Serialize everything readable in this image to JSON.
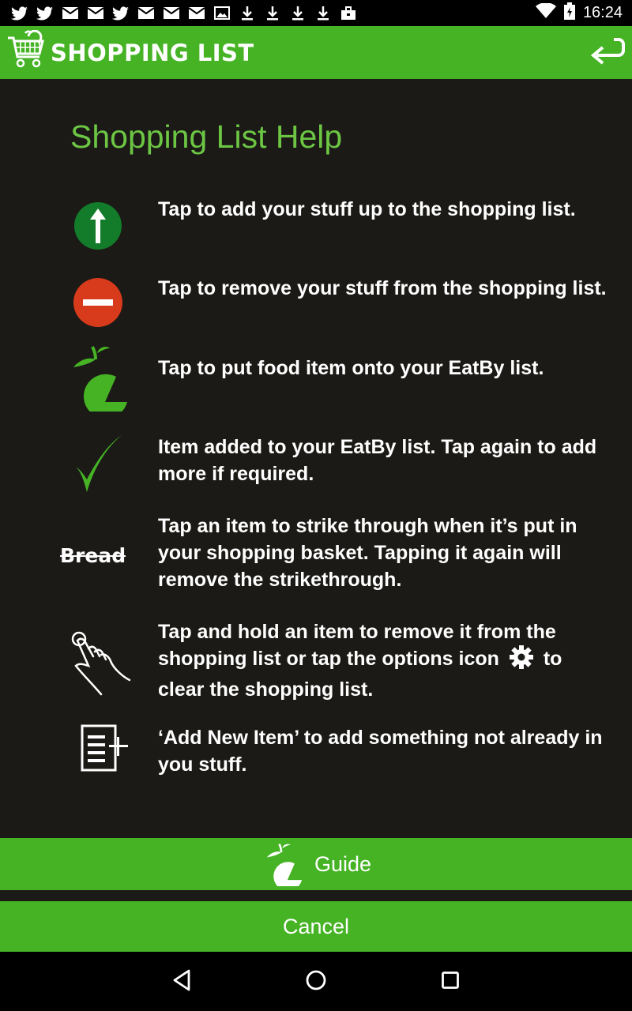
{
  "status_bar": {
    "time": "16:24",
    "notification_icons": [
      "twitter-icon",
      "twitter-icon",
      "mail-icon",
      "mail-icon",
      "twitter-icon",
      "mail-icon",
      "mail-icon",
      "mail-icon",
      "image-icon",
      "download-icon",
      "download-icon",
      "download-icon",
      "download-icon",
      "briefcase-icon"
    ],
    "system_icons": [
      "wifi-icon",
      "battery-icon"
    ]
  },
  "app_bar": {
    "title": "SHOPPING LIST",
    "back_icon": "back-arrow-icon"
  },
  "help": {
    "title": "Shopping List Help",
    "items": [
      {
        "icon": "green-up-arrow-icon",
        "text": "Tap to add your stuff up to the shopping list."
      },
      {
        "icon": "red-remove-icon",
        "text": "Tap to remove your stuff from the shopping list."
      },
      {
        "icon": "eatby-leaf-icon",
        "text": "Tap to put food item onto your EatBy list."
      },
      {
        "icon": "green-checkmark-icon",
        "text": "Item added to your EatBy list. Tap again to add more if required."
      },
      {
        "icon": "strikethrough-example",
        "example_word": "Bread",
        "text": "Tap an item to strike through when it’s put in your shopping basket. Tapping it again will remove the strikethrough."
      },
      {
        "icon": "tap-hold-hand-icon",
        "text_before": "Tap and hold an item to remove it from the shopping list or tap the options icon",
        "inline_icon": "gear-icon",
        "text_after": "to clear the shopping list."
      },
      {
        "icon": "add-new-item-icon",
        "text": "‘Add New Item’ to add something not already in you stuff."
      }
    ]
  },
  "buttons": {
    "guide_label": "Guide",
    "cancel_label": "Cancel"
  },
  "nav_bar": {
    "icons": [
      "back-triangle-icon",
      "home-circle-icon",
      "recents-square-icon"
    ]
  },
  "colors": {
    "brand_green": "#45b324",
    "title_green": "#6cc644",
    "background": "#1b1a16",
    "remove_red": "#d83a1c",
    "arrow_dark_green": "#137c2a"
  }
}
